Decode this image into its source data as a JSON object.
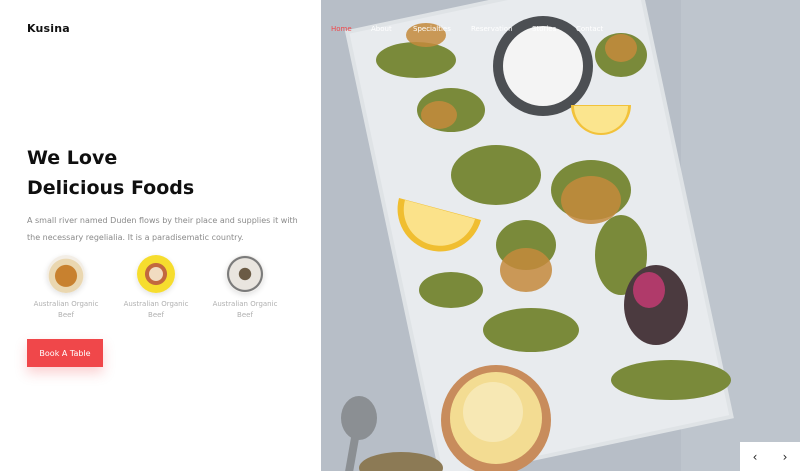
{
  "brand": {
    "name": "Kusina"
  },
  "nav": {
    "items": [
      {
        "label": "Home",
        "active": true
      },
      {
        "label": "About",
        "active": false
      },
      {
        "label": "Specialties",
        "active": false
      },
      {
        "label": "Reservation",
        "active": false
      },
      {
        "label": "Stories",
        "active": false
      },
      {
        "label": "Contact",
        "active": false
      }
    ]
  },
  "hero": {
    "title_line1": "We Love",
    "title_line2": "Delicious Foods",
    "description": "A small river named Duden flows by their place and supplies it with the necessary regelialia. It is a paradisematic country.",
    "button_label": "Book A Table"
  },
  "features": [
    {
      "label": "Australian Organic Beef",
      "icon": "burger-plate-photo"
    },
    {
      "label": "Australian Organic Beef",
      "icon": "dish-yellow-plate-photo"
    },
    {
      "label": "Australian Organic Beef",
      "icon": "dish-white-plate-photo"
    }
  ],
  "slider": {
    "prev_icon": "‹",
    "next_icon": "›"
  },
  "colors": {
    "accent": "#f0474a",
    "text": "#111111",
    "muted": "#8a8a8a"
  }
}
